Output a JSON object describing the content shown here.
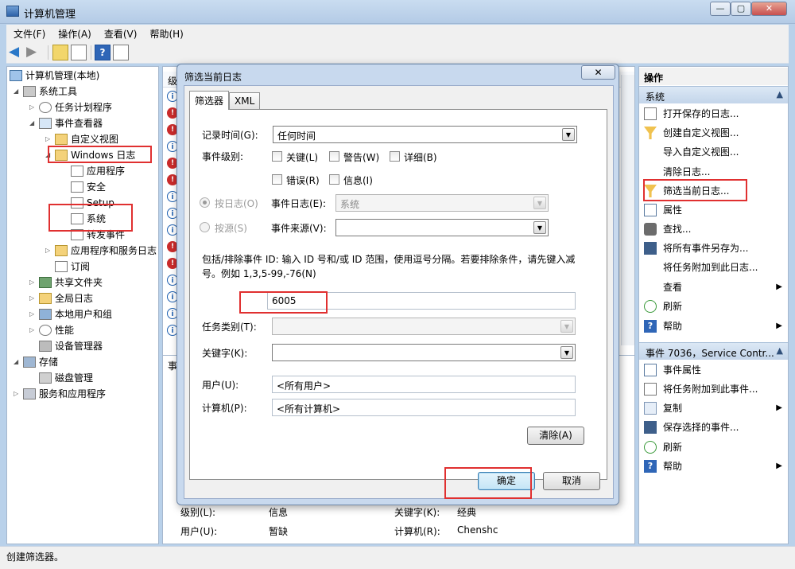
{
  "window": {
    "title": "计算机管理",
    "min": "—",
    "max": "▢",
    "close": "✕"
  },
  "menu": [
    "文件(F)",
    "操作(A)",
    "查看(V)",
    "帮助(H)"
  ],
  "tree": {
    "root": "计算机管理(本地)",
    "system_tools": "系统工具",
    "task_scheduler": "任务计划程序",
    "event_viewer": "事件查看器",
    "custom_views": "自定义视图",
    "windows_logs": "Windows 日志",
    "application": "应用程序",
    "security": "安全",
    "setup": "Setup",
    "system": "系统",
    "forwarded": "转发事件",
    "app_service_logs": "应用程序和服务日志",
    "subscriptions": "订阅",
    "shared_folders": "共享文件夹",
    "global_logs": "全局日志",
    "local_users": "本地用户和组",
    "performance": "性能",
    "device_manager": "设备管理器",
    "storage": "存储",
    "disk_management": "磁盘管理",
    "services_apps": "服务和应用程序"
  },
  "center": {
    "col_level": "级",
    "details_header": "事",
    "details": {
      "level_label": "级别(L):",
      "level_value": "信息",
      "keywords_label": "关键字(K):",
      "keywords_value": "经典",
      "user_label": "用户(U):",
      "user_value": "暂缺",
      "computer_label": "计算机(R):",
      "computer_value": "Chenshc"
    },
    "event_types": [
      "info",
      "err",
      "err",
      "info",
      "err",
      "err",
      "info",
      "info",
      "info",
      "err",
      "err",
      "info",
      "info",
      "info",
      "info"
    ]
  },
  "actions": {
    "header": "操作",
    "section1": "系统",
    "items1": [
      "打开保存的日志...",
      "创建自定义视图...",
      "导入自定义视图...",
      "清除日志...",
      "筛选当前日志...",
      "属性",
      "查找...",
      "将所有事件另存为...",
      "将任务附加到此日志...",
      "查看",
      "刷新",
      "帮助"
    ],
    "section2": "事件 7036，Service Contr...",
    "items2": [
      "事件属性",
      "将任务附加到此事件...",
      "复制",
      "保存选择的事件...",
      "刷新",
      "帮助"
    ]
  },
  "status": "创建筛选器。",
  "dialog": {
    "title": "筛选当前日志",
    "close": "✕",
    "tab_filter": "筛选器",
    "tab_xml": "XML",
    "logged_label": "记录时间(G):",
    "logged_value": "任何时间",
    "level_label": "事件级别:",
    "critical": "关键(L)",
    "warning": "警告(W)",
    "verbose": "详细(B)",
    "error": "错误(R)",
    "information": "信息(I)",
    "by_log": "按日志(O)",
    "event_logs_label": "事件日志(E):",
    "event_logs_value": "系统",
    "by_source": "按源(S)",
    "event_sources_label": "事件来源(V):",
    "event_sources_value": "",
    "id_hint": "包括/排除事件 ID: 输入 ID 号和/或 ID 范围，使用逗号分隔。若要排除条件，请先键入减号。例如 1,3,5-99,-76(N)",
    "event_id_value": "6005",
    "task_category_label": "任务类别(T):",
    "keywords_label": "关键字(K):",
    "user_label": "用户(U):",
    "user_value": "<所有用户>",
    "computer_label": "计算机(P):",
    "computer_value": "<所有计算机>",
    "clear_button": "清除(A)",
    "ok_button": "确定",
    "cancel_button": "取消"
  }
}
